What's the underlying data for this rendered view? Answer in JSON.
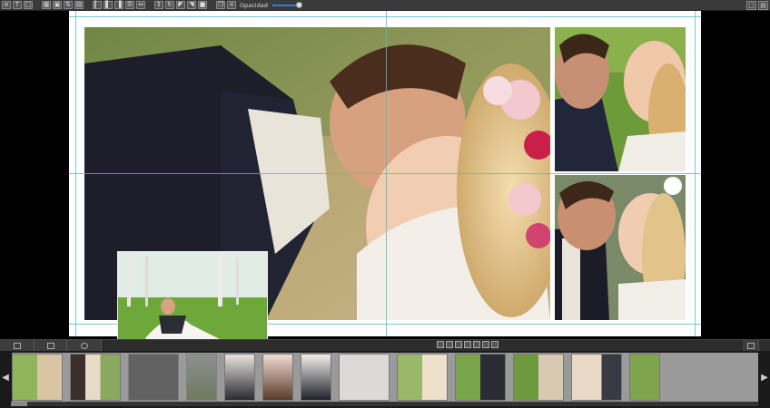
{
  "toolbar": {
    "opacity_label": "Opacidad",
    "opacity_value": 1.0
  },
  "icons": {
    "tools": [
      "layout-icon",
      "text-icon",
      "frame-icon",
      "grid-icon",
      "crop-icon",
      "fit-icon",
      "align-left-icon",
      "align-center-icon",
      "align-right-icon",
      "distribute-icon",
      "flip-h-icon",
      "flip-v-icon",
      "rotate-icon",
      "bring-front-icon",
      "send-back-icon",
      "lock-icon",
      "delete-icon"
    ],
    "right": [
      "window-icon",
      "panel-icon"
    ]
  },
  "bottom_panel": {
    "tab_icons": [
      "photos-icon",
      "pages-icon",
      "backgrounds-icon"
    ],
    "mid_tool_icons": [
      "zoom-icon",
      "rotate-icon",
      "info-icon",
      "sort-icon",
      "list-icon",
      "delete-icon",
      "export-icon"
    ]
  },
  "colors": {
    "toolbar_bg": "#3a3a3a",
    "accent": "#2f7fd6",
    "guide": "#50bec8",
    "strip_bg": "#9a9a9a"
  }
}
